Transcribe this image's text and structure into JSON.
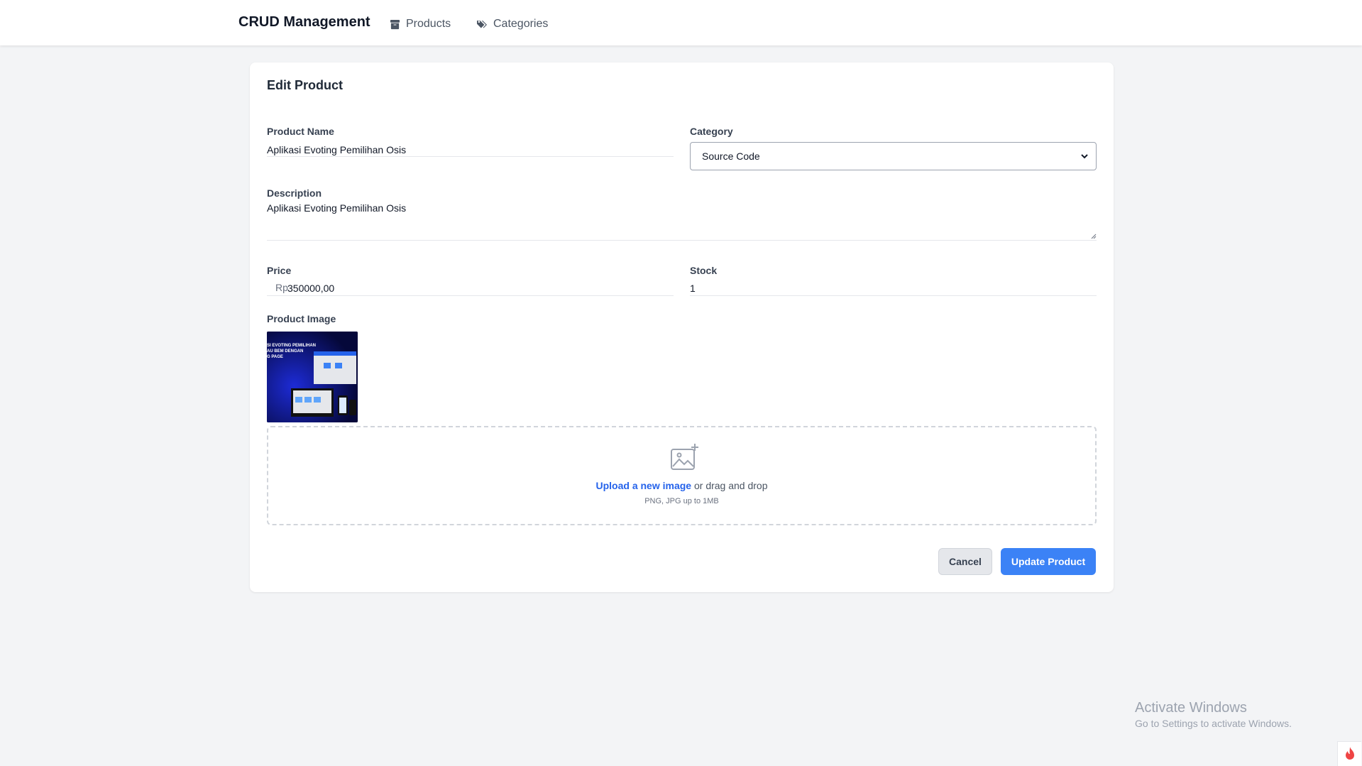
{
  "nav": {
    "brand": "CRUD Management",
    "links": [
      {
        "label": "Products",
        "icon": "box-icon"
      },
      {
        "label": "Categories",
        "icon": "tags-icon"
      }
    ]
  },
  "form": {
    "title": "Edit Product",
    "product_name": {
      "label": "Product Name",
      "value": "Aplikasi Evoting Pemilihan Osis"
    },
    "category": {
      "label": "Category",
      "selected": "Source Code"
    },
    "description": {
      "label": "Description",
      "value": "Aplikasi Evoting Pemilihan Osis"
    },
    "price": {
      "label": "Price",
      "prefix": "Rp",
      "value": "350000,00"
    },
    "stock": {
      "label": "Stock",
      "value": "1"
    },
    "image": {
      "label": "Product Image",
      "thumb_lines": [
        "SI EVOTING PEMILIHAN",
        "AU BEM DENGAN",
        "G PAGE"
      ],
      "upload_link": "Upload a new image",
      "upload_rest": " or drag and drop",
      "hint": "PNG, JPG up to 1MB"
    },
    "cancel_label": "Cancel",
    "submit_label": "Update Product"
  },
  "watermark": {
    "title": "Activate Windows",
    "subtitle": "Go to Settings to activate Windows."
  },
  "colors": {
    "primary": "#3b82f6",
    "link": "#2563eb",
    "background": "#f3f4f6"
  }
}
